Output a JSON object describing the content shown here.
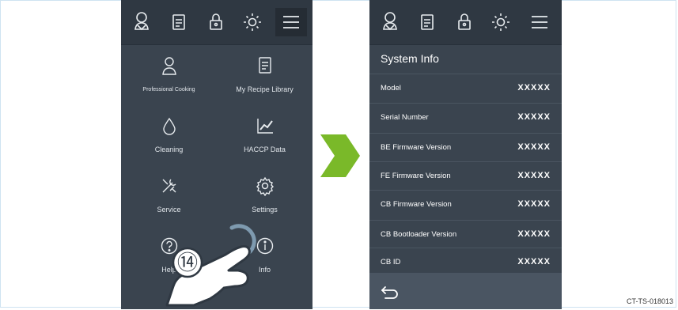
{
  "menu_screen": {
    "tiles": [
      {
        "label": "Professional Cooking",
        "icon": "chef-icon"
      },
      {
        "label": "My Recipe Library",
        "icon": "recipe-book-icon"
      },
      {
        "label": "Cleaning",
        "icon": "water-drop-icon"
      },
      {
        "label": "HACCP Data",
        "icon": "chart-icon"
      },
      {
        "label": "Service",
        "icon": "tools-icon"
      },
      {
        "label": "Settings",
        "icon": "gear-icon"
      },
      {
        "label": "Help",
        "icon": "help-icon"
      },
      {
        "label": "Info",
        "icon": "info-icon"
      }
    ]
  },
  "topbar_icons": [
    "chef-icon",
    "recipe-book-icon",
    "lock-icon",
    "brightness-icon",
    "menu-icon"
  ],
  "step_marker": "⑭",
  "info_screen": {
    "title": "System Info",
    "rows": [
      {
        "label": "Model",
        "value": "XXXXX"
      },
      {
        "label": "Serial Number",
        "value": "XXXXX"
      },
      {
        "label": "BE Firmware Version",
        "value": "XXXXX"
      },
      {
        "label": "FE Firmware Version",
        "value": "XXXXX"
      },
      {
        "label": "CB Firmware Version",
        "value": "XXXXX"
      },
      {
        "label": "CB Bootloader Version",
        "value": "XXXXX"
      },
      {
        "label": "CB ID",
        "value": "XXXXX"
      }
    ]
  },
  "caption": "CT-TS-018013",
  "colors": {
    "screen_bg": "#3a444f",
    "topbar_bg": "#2f3842",
    "arrow_green": "#7ab929",
    "bottombar_bg": "#4a5562"
  }
}
